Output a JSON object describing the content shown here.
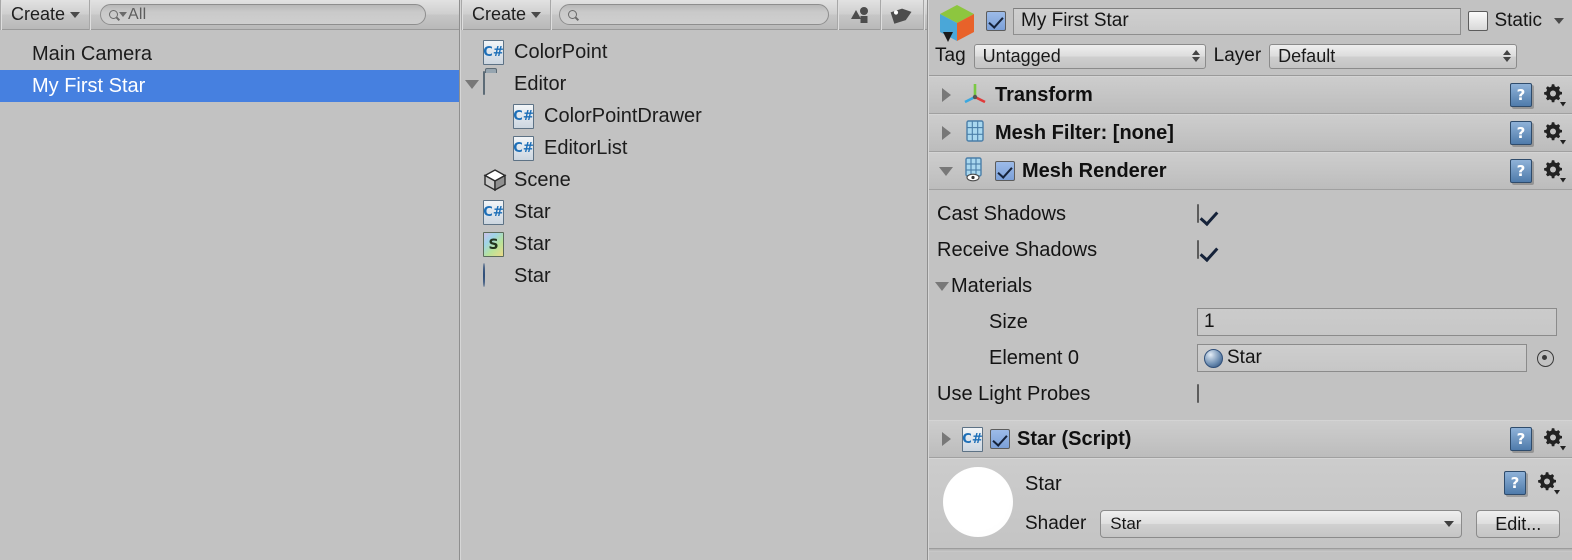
{
  "hierarchy_panel": {
    "toolbar": {
      "create_label": "Create",
      "search_value": "All",
      "search_icon": "search-icon"
    },
    "items": [
      {
        "label": "Main Camera",
        "selected": false
      },
      {
        "label": "My First Star",
        "selected": true
      }
    ]
  },
  "project_panel": {
    "toolbar": {
      "create_label": "Create",
      "search_value": "",
      "search_placeholder": "",
      "filter_type_icon": "type-filter-icon",
      "filter_label_icon": "label-filter-icon"
    },
    "items": [
      {
        "label": "ColorPoint",
        "icon": "csharp-script-icon",
        "indent": 1,
        "foldout": "none"
      },
      {
        "label": "Editor",
        "icon": "folder-icon",
        "indent": 0,
        "foldout": "expanded"
      },
      {
        "label": "ColorPointDrawer",
        "icon": "csharp-script-icon",
        "indent": 2,
        "foldout": "none"
      },
      {
        "label": "EditorList",
        "icon": "csharp-script-icon",
        "indent": 2,
        "foldout": "none"
      },
      {
        "label": "Scene",
        "icon": "unity-scene-icon",
        "indent": 1,
        "foldout": "none"
      },
      {
        "label": "Star",
        "icon": "csharp-script-icon",
        "indent": 1,
        "foldout": "none"
      },
      {
        "label": "Star",
        "icon": "shader-icon",
        "indent": 1,
        "foldout": "none"
      },
      {
        "label": "Star",
        "icon": "material-icon",
        "indent": 1,
        "foldout": "none"
      }
    ]
  },
  "inspector": {
    "object_name": "My First Star",
    "enabled": true,
    "static_label": "Static",
    "static_checked": false,
    "tag_label": "Tag",
    "tag_value": "Untagged",
    "layer_label": "Layer",
    "layer_value": "Default",
    "components": [
      {
        "title": "Transform",
        "icon": "transform-icon",
        "expanded": false,
        "has_checkbox": false
      },
      {
        "title": "Mesh Filter: [none]",
        "icon": "mesh-filter-icon",
        "expanded": false,
        "has_checkbox": false
      },
      {
        "title": "Mesh Renderer",
        "icon": "mesh-renderer-icon",
        "expanded": true,
        "has_checkbox": true,
        "checked": true
      },
      {
        "title": "Star (Script)",
        "icon": "csharp-script-icon",
        "expanded": false,
        "has_checkbox": true,
        "checked": true
      }
    ],
    "mesh_renderer": {
      "cast_shadows_label": "Cast Shadows",
      "cast_shadows_checked": true,
      "receive_shadows_label": "Receive Shadows",
      "receive_shadows_checked": true,
      "materials_label": "Materials",
      "materials_expanded": true,
      "size_label": "Size",
      "size_value": "1",
      "element0_label": "Element 0",
      "element0_value": "Star",
      "use_light_probes_label": "Use Light Probes",
      "use_light_probes_checked": false
    },
    "material_block": {
      "material_name": "Star",
      "shader_label": "Shader",
      "shader_value": "Star",
      "edit_label": "Edit..."
    },
    "icons": {
      "help": "help-icon",
      "settings": "gear-icon",
      "help_glyph": "?"
    }
  },
  "colors": {
    "background": "#c2c2c2",
    "selection": "#4680e0",
    "panel_border": "#8f8f8f",
    "text": "#151515"
  }
}
